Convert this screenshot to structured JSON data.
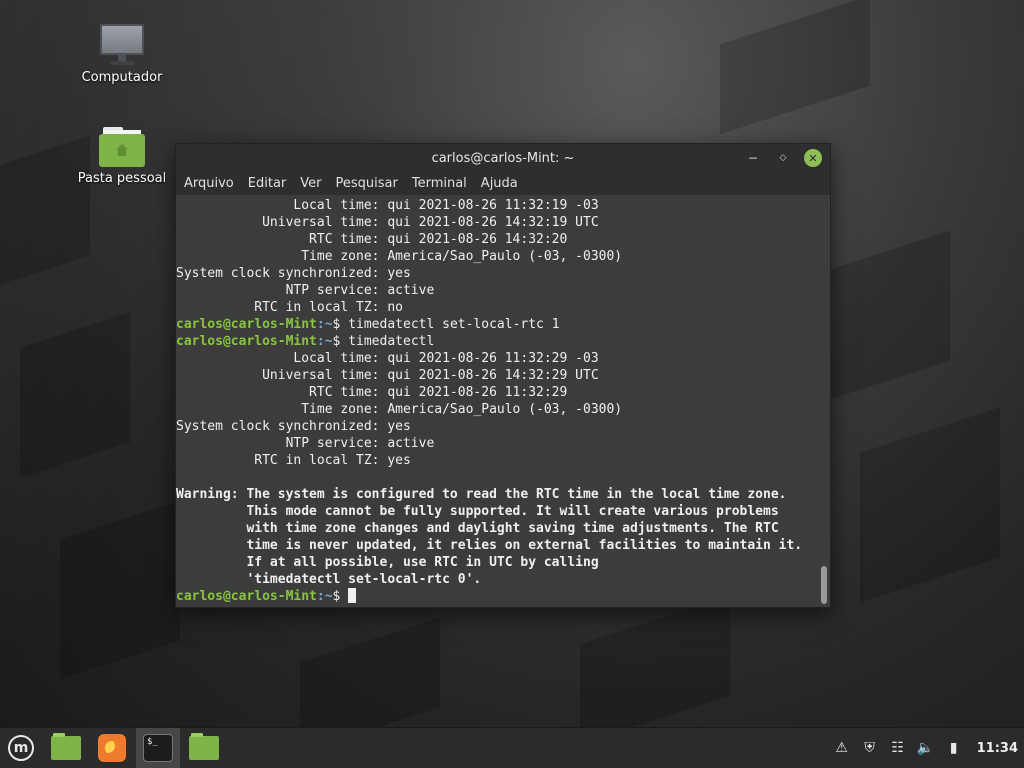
{
  "desktop": {
    "icons": [
      {
        "label": "Computador"
      },
      {
        "label": "Pasta pessoal"
      }
    ]
  },
  "window": {
    "title": "carlos@carlos-Mint: ~",
    "menu": [
      "Arquivo",
      "Editar",
      "Ver",
      "Pesquisar",
      "Terminal",
      "Ajuda"
    ]
  },
  "terminal": {
    "prompt_user": "carlos@carlos-Mint",
    "prompt_path": ":~",
    "prompt_symbol": "$ ",
    "lines": [
      {
        "type": "out",
        "text": "               Local time: qui 2021-08-26 11:32:19 -03"
      },
      {
        "type": "out",
        "text": "           Universal time: qui 2021-08-26 14:32:19 UTC"
      },
      {
        "type": "out",
        "text": "                 RTC time: qui 2021-08-26 14:32:20"
      },
      {
        "type": "out",
        "text": "                Time zone: America/Sao_Paulo (-03, -0300)"
      },
      {
        "type": "out",
        "text": "System clock synchronized: yes"
      },
      {
        "type": "out",
        "text": "              NTP service: active"
      },
      {
        "type": "out",
        "text": "          RTC in local TZ: no"
      },
      {
        "type": "cmd",
        "text": "timedatectl set-local-rtc 1"
      },
      {
        "type": "cmd",
        "text": "timedatectl"
      },
      {
        "type": "out",
        "text": "               Local time: qui 2021-08-26 11:32:29 -03"
      },
      {
        "type": "out",
        "text": "           Universal time: qui 2021-08-26 14:32:29 UTC"
      },
      {
        "type": "out",
        "text": "                 RTC time: qui 2021-08-26 11:32:29"
      },
      {
        "type": "out",
        "text": "                Time zone: America/Sao_Paulo (-03, -0300)"
      },
      {
        "type": "out",
        "text": "System clock synchronized: yes"
      },
      {
        "type": "out",
        "text": "              NTP service: active"
      },
      {
        "type": "out",
        "text": "          RTC in local TZ: yes"
      },
      {
        "type": "out",
        "text": ""
      },
      {
        "type": "warn",
        "text": "Warning: The system is configured to read the RTC time in the local time zone."
      },
      {
        "type": "warn",
        "text": "         This mode cannot be fully supported. It will create various problems"
      },
      {
        "type": "warn",
        "text": "         with time zone changes and daylight saving time adjustments. The RTC"
      },
      {
        "type": "warn",
        "text": "         time is never updated, it relies on external facilities to maintain it."
      },
      {
        "type": "warn",
        "text": "         If at all possible, use RTC in UTC by calling"
      },
      {
        "type": "warn",
        "text": "         'timedatectl set-local-rtc 0'."
      },
      {
        "type": "prompt",
        "text": ""
      }
    ]
  },
  "taskbar": {
    "launchers": [
      {
        "name": "files-launcher-icon"
      },
      {
        "name": "firefox-launcher-icon"
      },
      {
        "name": "terminal-launcher-icon",
        "label": "$_"
      },
      {
        "name": "folder-window-icon"
      }
    ],
    "tray_icons": [
      "notification-icon",
      "shield-icon",
      "network-icon",
      "volume-icon",
      "battery-icon"
    ],
    "clock": "11:34"
  }
}
